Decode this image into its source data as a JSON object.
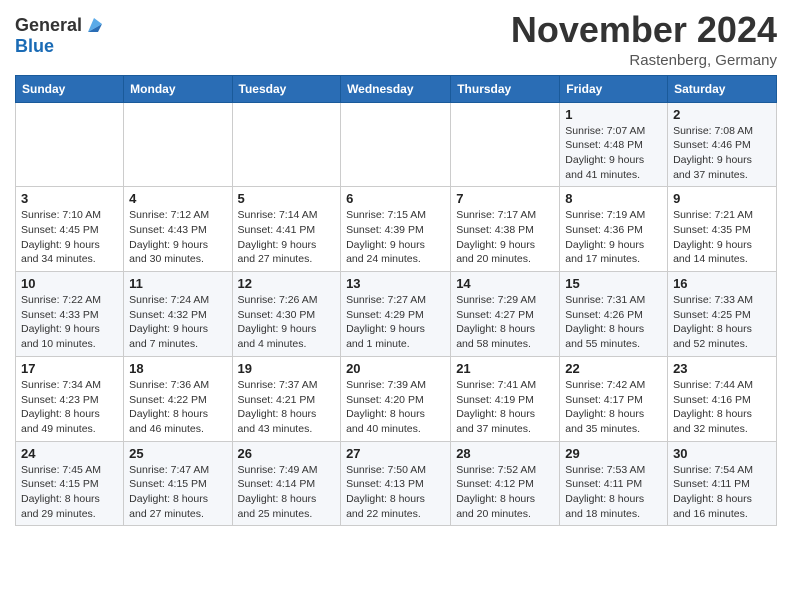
{
  "logo": {
    "general": "General",
    "blue": "Blue"
  },
  "title": "November 2024",
  "location": "Rastenberg, Germany",
  "days_header": [
    "Sunday",
    "Monday",
    "Tuesday",
    "Wednesday",
    "Thursday",
    "Friday",
    "Saturday"
  ],
  "weeks": [
    [
      {
        "day": "",
        "info": ""
      },
      {
        "day": "",
        "info": ""
      },
      {
        "day": "",
        "info": ""
      },
      {
        "day": "",
        "info": ""
      },
      {
        "day": "",
        "info": ""
      },
      {
        "day": "1",
        "info": "Sunrise: 7:07 AM\nSunset: 4:48 PM\nDaylight: 9 hours and 41 minutes."
      },
      {
        "day": "2",
        "info": "Sunrise: 7:08 AM\nSunset: 4:46 PM\nDaylight: 9 hours and 37 minutes."
      }
    ],
    [
      {
        "day": "3",
        "info": "Sunrise: 7:10 AM\nSunset: 4:45 PM\nDaylight: 9 hours and 34 minutes."
      },
      {
        "day": "4",
        "info": "Sunrise: 7:12 AM\nSunset: 4:43 PM\nDaylight: 9 hours and 30 minutes."
      },
      {
        "day": "5",
        "info": "Sunrise: 7:14 AM\nSunset: 4:41 PM\nDaylight: 9 hours and 27 minutes."
      },
      {
        "day": "6",
        "info": "Sunrise: 7:15 AM\nSunset: 4:39 PM\nDaylight: 9 hours and 24 minutes."
      },
      {
        "day": "7",
        "info": "Sunrise: 7:17 AM\nSunset: 4:38 PM\nDaylight: 9 hours and 20 minutes."
      },
      {
        "day": "8",
        "info": "Sunrise: 7:19 AM\nSunset: 4:36 PM\nDaylight: 9 hours and 17 minutes."
      },
      {
        "day": "9",
        "info": "Sunrise: 7:21 AM\nSunset: 4:35 PM\nDaylight: 9 hours and 14 minutes."
      }
    ],
    [
      {
        "day": "10",
        "info": "Sunrise: 7:22 AM\nSunset: 4:33 PM\nDaylight: 9 hours and 10 minutes."
      },
      {
        "day": "11",
        "info": "Sunrise: 7:24 AM\nSunset: 4:32 PM\nDaylight: 9 hours and 7 minutes."
      },
      {
        "day": "12",
        "info": "Sunrise: 7:26 AM\nSunset: 4:30 PM\nDaylight: 9 hours and 4 minutes."
      },
      {
        "day": "13",
        "info": "Sunrise: 7:27 AM\nSunset: 4:29 PM\nDaylight: 9 hours and 1 minute."
      },
      {
        "day": "14",
        "info": "Sunrise: 7:29 AM\nSunset: 4:27 PM\nDaylight: 8 hours and 58 minutes."
      },
      {
        "day": "15",
        "info": "Sunrise: 7:31 AM\nSunset: 4:26 PM\nDaylight: 8 hours and 55 minutes."
      },
      {
        "day": "16",
        "info": "Sunrise: 7:33 AM\nSunset: 4:25 PM\nDaylight: 8 hours and 52 minutes."
      }
    ],
    [
      {
        "day": "17",
        "info": "Sunrise: 7:34 AM\nSunset: 4:23 PM\nDaylight: 8 hours and 49 minutes."
      },
      {
        "day": "18",
        "info": "Sunrise: 7:36 AM\nSunset: 4:22 PM\nDaylight: 8 hours and 46 minutes."
      },
      {
        "day": "19",
        "info": "Sunrise: 7:37 AM\nSunset: 4:21 PM\nDaylight: 8 hours and 43 minutes."
      },
      {
        "day": "20",
        "info": "Sunrise: 7:39 AM\nSunset: 4:20 PM\nDaylight: 8 hours and 40 minutes."
      },
      {
        "day": "21",
        "info": "Sunrise: 7:41 AM\nSunset: 4:19 PM\nDaylight: 8 hours and 37 minutes."
      },
      {
        "day": "22",
        "info": "Sunrise: 7:42 AM\nSunset: 4:17 PM\nDaylight: 8 hours and 35 minutes."
      },
      {
        "day": "23",
        "info": "Sunrise: 7:44 AM\nSunset: 4:16 PM\nDaylight: 8 hours and 32 minutes."
      }
    ],
    [
      {
        "day": "24",
        "info": "Sunrise: 7:45 AM\nSunset: 4:15 PM\nDaylight: 8 hours and 29 minutes."
      },
      {
        "day": "25",
        "info": "Sunrise: 7:47 AM\nSunset: 4:15 PM\nDaylight: 8 hours and 27 minutes."
      },
      {
        "day": "26",
        "info": "Sunrise: 7:49 AM\nSunset: 4:14 PM\nDaylight: 8 hours and 25 minutes."
      },
      {
        "day": "27",
        "info": "Sunrise: 7:50 AM\nSunset: 4:13 PM\nDaylight: 8 hours and 22 minutes."
      },
      {
        "day": "28",
        "info": "Sunrise: 7:52 AM\nSunset: 4:12 PM\nDaylight: 8 hours and 20 minutes."
      },
      {
        "day": "29",
        "info": "Sunrise: 7:53 AM\nSunset: 4:11 PM\nDaylight: 8 hours and 18 minutes."
      },
      {
        "day": "30",
        "info": "Sunrise: 7:54 AM\nSunset: 4:11 PM\nDaylight: 8 hours and 16 minutes."
      }
    ]
  ]
}
